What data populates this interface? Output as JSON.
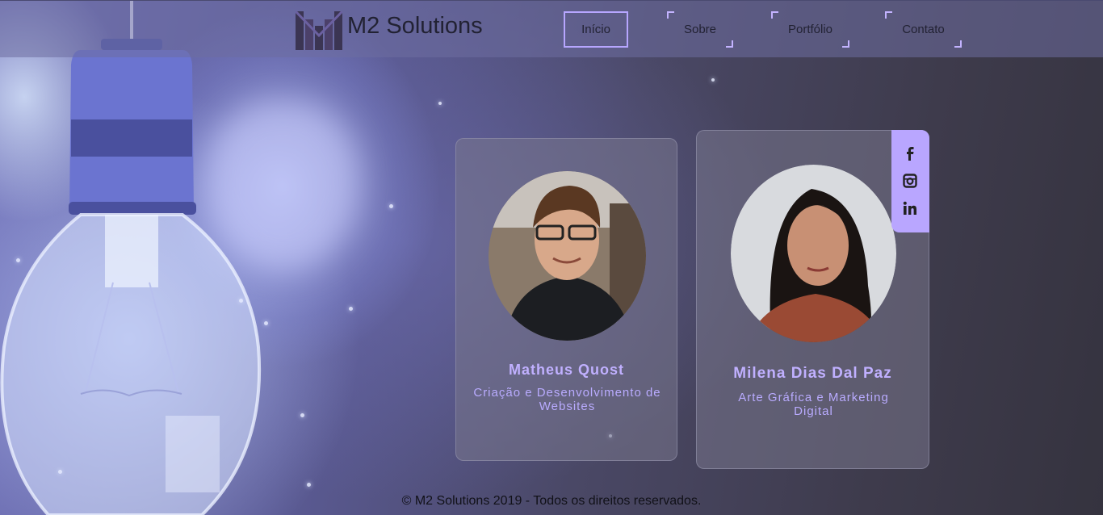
{
  "brand": {
    "name": "M2 Solutions"
  },
  "nav": {
    "items": [
      {
        "label": "Início"
      },
      {
        "label": "Sobre"
      },
      {
        "label": "Portfólio"
      },
      {
        "label": "Contato"
      }
    ]
  },
  "team": {
    "members": [
      {
        "name": "Matheus Quost",
        "role": "Criação e Desenvolvimento de Websites"
      },
      {
        "name": "Milena Dias Dal Paz",
        "role": "Arte Gráfica e Marketing Digital"
      }
    ],
    "social_icons": [
      "facebook-icon",
      "instagram-icon",
      "linkedin-icon"
    ]
  },
  "footer": {
    "text": "© M2 Solutions 2019 - Todos os direitos reservados."
  },
  "colors": {
    "accent": "#b9a6ff",
    "text_accent": "#c0b0ff"
  }
}
